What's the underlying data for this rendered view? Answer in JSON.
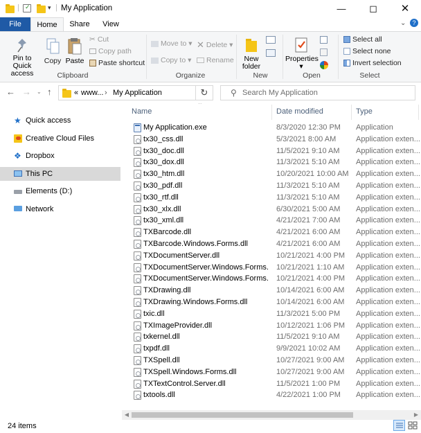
{
  "window": {
    "title": "My Application"
  },
  "ribbon_tabs": [
    "File",
    "Home",
    "Share",
    "View"
  ],
  "clipboard": {
    "pin_label_1": "Pin to Quick",
    "pin_label_2": "access",
    "copy": "Copy",
    "paste": "Paste",
    "cut": "Cut",
    "copy_path": "Copy path",
    "paste_shortcut": "Paste shortcut",
    "group": "Clipboard"
  },
  "organize": {
    "move_to": "Move to",
    "copy_to": "Copy to",
    "delete": "Delete",
    "rename": "Rename",
    "group": "Organize"
  },
  "new": {
    "folder_1": "New",
    "folder_2": "folder",
    "group": "New"
  },
  "open": {
    "properties": "Properties",
    "group": "Open"
  },
  "select": {
    "select_all": "Select all",
    "select_none": "Select none",
    "invert": "Invert selection",
    "group": "Select"
  },
  "address": {
    "crumb_root": "www...",
    "crumb_leaf": "My Application",
    "overflow": "«"
  },
  "search": {
    "placeholder": "Search My Application"
  },
  "nav": [
    {
      "label": "Quick access",
      "icon": "star-icon"
    },
    {
      "label": "Creative Cloud Files",
      "icon": "creative-cloud-icon"
    },
    {
      "label": "Dropbox",
      "icon": "dropbox-icon"
    },
    {
      "label": "This PC",
      "icon": "computer-icon"
    },
    {
      "label": "Elements (D:)",
      "icon": "drive-icon"
    },
    {
      "label": "Network",
      "icon": "network-icon"
    }
  ],
  "columns": {
    "name": "Name",
    "date": "Date modified",
    "type": "Type"
  },
  "files": [
    {
      "name": "My Application.exe",
      "date": "8/3/2020 12:30 PM",
      "type": "Application"
    },
    {
      "name": "tx30_css.dll",
      "date": "5/3/2021 8:00 AM",
      "type": "Application exten..."
    },
    {
      "name": "tx30_doc.dll",
      "date": "11/5/2021 9:10 AM",
      "type": "Application exten..."
    },
    {
      "name": "tx30_dox.dll",
      "date": "11/3/2021 5:10 AM",
      "type": "Application exten..."
    },
    {
      "name": "tx30_htm.dll",
      "date": "10/20/2021 10:00 AM",
      "type": "Application exten..."
    },
    {
      "name": "tx30_pdf.dll",
      "date": "11/3/2021 5:10 AM",
      "type": "Application exten..."
    },
    {
      "name": "tx30_rtf.dll",
      "date": "11/3/2021 5:10 AM",
      "type": "Application exten..."
    },
    {
      "name": "tx30_xlx.dll",
      "date": "6/30/2021 5:00 AM",
      "type": "Application exten..."
    },
    {
      "name": "tx30_xml.dll",
      "date": "4/21/2021 7:00 AM",
      "type": "Application exten..."
    },
    {
      "name": "TXBarcode.dll",
      "date": "4/21/2021 6:00 AM",
      "type": "Application exten..."
    },
    {
      "name": "TXBarcode.Windows.Forms.dll",
      "date": "4/21/2021 6:00 AM",
      "type": "Application exten..."
    },
    {
      "name": "TXDocumentServer.dll",
      "date": "10/21/2021 4:00 PM",
      "type": "Application exten..."
    },
    {
      "name": "TXDocumentServer.Windows.Forms.Desi...",
      "date": "10/21/2021 1:10 AM",
      "type": "Application exten..."
    },
    {
      "name": "TXDocumentServer.Windows.Forms.dll",
      "date": "10/21/2021 4:00 PM",
      "type": "Application exten..."
    },
    {
      "name": "TXDrawing.dll",
      "date": "10/14/2021 6:00 AM",
      "type": "Application exten..."
    },
    {
      "name": "TXDrawing.Windows.Forms.dll",
      "date": "10/14/2021 6:00 AM",
      "type": "Application exten..."
    },
    {
      "name": "txic.dll",
      "date": "11/3/2021 5:00 PM",
      "type": "Application exten..."
    },
    {
      "name": "TXImageProvider.dll",
      "date": "10/12/2021 1:06 PM",
      "type": "Application exten..."
    },
    {
      "name": "txkernel.dll",
      "date": "11/5/2021 9:10 AM",
      "type": "Application exten..."
    },
    {
      "name": "txpdf.dll",
      "date": "9/9/2021 10:02 AM",
      "type": "Application exten..."
    },
    {
      "name": "TXSpell.dll",
      "date": "10/27/2021 9:00 AM",
      "type": "Application exten..."
    },
    {
      "name": "TXSpell.Windows.Forms.dll",
      "date": "10/27/2021 9:00 AM",
      "type": "Application exten..."
    },
    {
      "name": "TXTextControl.Server.dll",
      "date": "11/5/2021 1:00 PM",
      "type": "Application exten..."
    },
    {
      "name": "txtools.dll",
      "date": "4/22/2021 1:00 PM",
      "type": "Application exten..."
    }
  ],
  "status": {
    "item_count": "24 items"
  },
  "colors": {
    "file_tab": "#1f5aa6",
    "selected_nav": "#d9d9d9",
    "header_text": "#4c607a"
  }
}
